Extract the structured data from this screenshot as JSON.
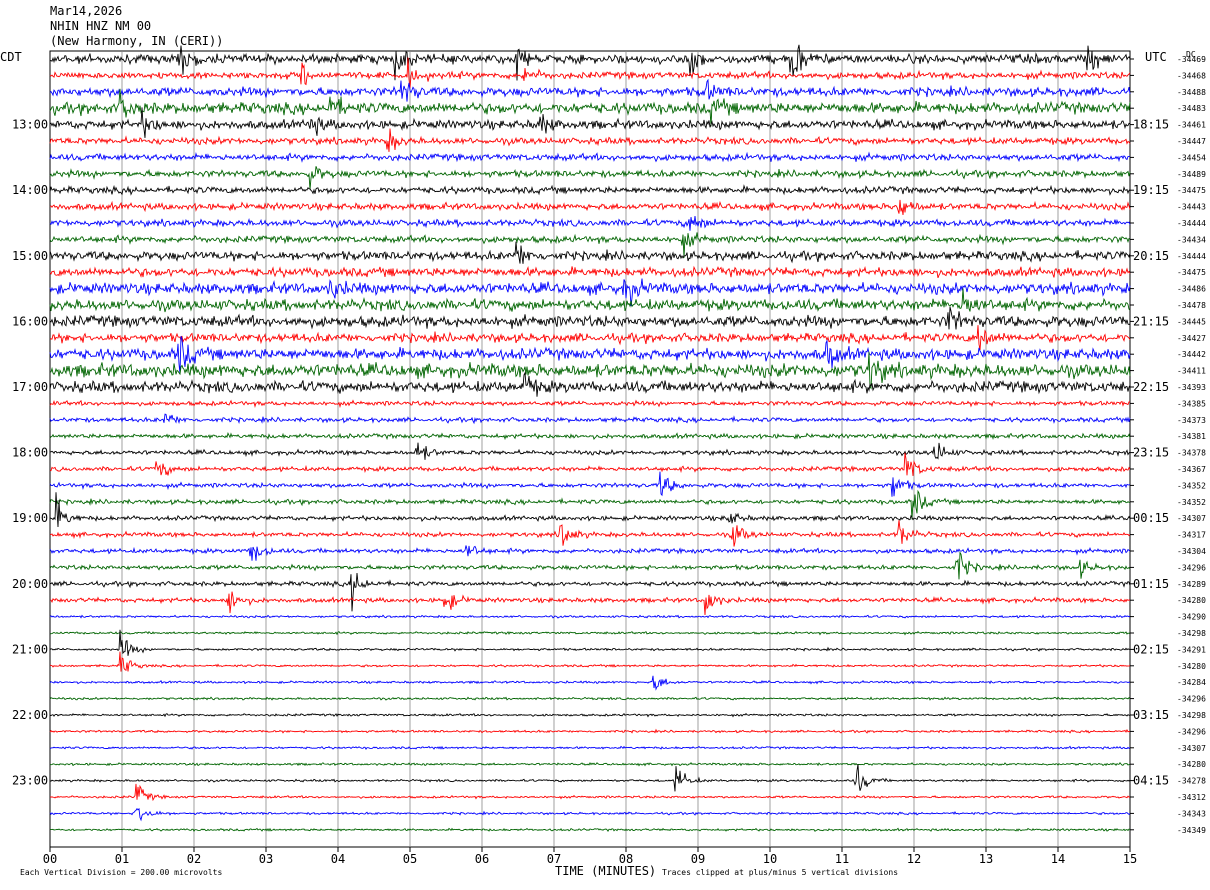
{
  "header": {
    "date": "Mar14,2026",
    "station": "NHIN HNZ NM 00",
    "location": "(New Harmony, IN (CERI))"
  },
  "left_tz": "CDT",
  "right_tz": "UTC",
  "dc_label": "DC",
  "footer": {
    "scale_note": "Each Vertical Division =  200.00 microvolts",
    "xlabel": "TIME (MINUTES)",
    "clip_note": "Traces clipped at plus/minus 5 vertical divisions"
  },
  "colors": [
    "#000000",
    "#ff0000",
    "#0000ff",
    "#006400"
  ],
  "chart_data": {
    "type": "line",
    "xlabel": "TIME (MINUTES)",
    "xlim": [
      0,
      15
    ],
    "x_ticks": [
      "00",
      "01",
      "02",
      "03",
      "04",
      "05",
      "06",
      "07",
      "08",
      "09",
      "10",
      "11",
      "12",
      "13",
      "14",
      "15"
    ],
    "left_hour_labels": [
      "13:00",
      "14:00",
      "15:00",
      "16:00",
      "17:00",
      "18:00",
      "19:00",
      "20:00",
      "21:00",
      "22:00",
      "23:00"
    ],
    "right_hour_labels": [
      "18:15",
      "19:15",
      "20:15",
      "21:15",
      "22:15",
      "23:15",
      "00:15",
      "01:15",
      "02:15",
      "03:15",
      "04:15"
    ],
    "dc_offsets": [
      "-34469",
      "-34468",
      "-34488",
      "-34483",
      "-34461",
      "-34447",
      "-34454",
      "-34489",
      "-34475",
      "-34443",
      "-34444",
      "-34434",
      "-34444",
      "-34475",
      "-34486",
      "-34478",
      "-34445",
      "-34427",
      "-34442",
      "-34411",
      "-34393",
      "-34385",
      "-34373",
      "-34381",
      "-34378",
      "-34367",
      "-34352",
      "-34352",
      "-34307",
      "-34317",
      "-34304",
      "-34296",
      "-34289",
      "-34280",
      "-34290",
      "-34298",
      "-34291",
      "-34280",
      "-34284",
      "-34296",
      "-34298",
      "-34296",
      "-34307",
      "-34280",
      "-34278",
      "-34312",
      "-34343",
      "-34349"
    ],
    "trace_noise_levels": [
      4,
      3,
      4,
      5,
      4,
      3,
      3,
      3,
      3,
      3,
      3,
      3,
      4,
      4,
      5,
      5,
      5,
      4,
      5,
      6,
      5,
      2,
      2,
      2,
      2,
      2,
      2,
      2,
      2,
      2,
      2,
      2,
      2,
      2,
      1,
      1,
      1,
      1,
      1,
      1,
      1,
      1,
      1,
      1,
      1,
      1,
      1,
      1
    ],
    "events": [
      {
        "trace": 0,
        "minute": 1.8,
        "amp": 18
      },
      {
        "trace": 0,
        "minute": 4.8,
        "amp": 16
      },
      {
        "trace": 0,
        "minute": 6.5,
        "amp": 14
      },
      {
        "trace": 0,
        "minute": 8.9,
        "amp": 14
      },
      {
        "trace": 0,
        "minute": 10.3,
        "amp": 26
      },
      {
        "trace": 0,
        "minute": 14.4,
        "amp": 16
      },
      {
        "trace": 1,
        "minute": 3.5,
        "amp": 12
      },
      {
        "trace": 1,
        "minute": 5.0,
        "amp": 10
      },
      {
        "trace": 1,
        "minute": 6.6,
        "amp": 10
      },
      {
        "trace": 2,
        "minute": 4.9,
        "amp": 14
      },
      {
        "trace": 2,
        "minute": 9.1,
        "amp": 10
      },
      {
        "trace": 3,
        "minute": 1.0,
        "amp": 12
      },
      {
        "trace": 3,
        "minute": 3.9,
        "amp": 12
      },
      {
        "trace": 3,
        "minute": 9.2,
        "amp": 10
      },
      {
        "trace": 4,
        "minute": 1.3,
        "amp": 10
      },
      {
        "trace": 4,
        "minute": 3.6,
        "amp": 12
      },
      {
        "trace": 4,
        "minute": 6.8,
        "amp": 10
      },
      {
        "trace": 5,
        "minute": 4.7,
        "amp": 10
      },
      {
        "trace": 7,
        "minute": 3.6,
        "amp": 12
      },
      {
        "trace": 9,
        "minute": 11.8,
        "amp": 12
      },
      {
        "trace": 10,
        "minute": 8.9,
        "amp": 12
      },
      {
        "trace": 11,
        "minute": 8.8,
        "amp": 10
      },
      {
        "trace": 12,
        "minute": 6.5,
        "amp": 12
      },
      {
        "trace": 14,
        "minute": 8.0,
        "amp": 16
      },
      {
        "trace": 14,
        "minute": 3.9,
        "amp": 10
      },
      {
        "trace": 15,
        "minute": 12.7,
        "amp": 16
      },
      {
        "trace": 16,
        "minute": 12.5,
        "amp": 12
      },
      {
        "trace": 17,
        "minute": 12.9,
        "amp": 16
      },
      {
        "trace": 18,
        "minute": 1.8,
        "amp": 18
      },
      {
        "trace": 18,
        "minute": 10.8,
        "amp": 14
      },
      {
        "trace": 19,
        "minute": 11.4,
        "amp": 16
      },
      {
        "trace": 20,
        "minute": 6.6,
        "amp": 12
      },
      {
        "trace": 22,
        "minute": 1.6,
        "amp": 8
      },
      {
        "trace": 24,
        "minute": 5.1,
        "amp": 12
      },
      {
        "trace": 24,
        "minute": 12.3,
        "amp": 12
      },
      {
        "trace": 25,
        "minute": 1.5,
        "amp": 10
      },
      {
        "trace": 25,
        "minute": 11.9,
        "amp": 16
      },
      {
        "trace": 26,
        "minute": 8.5,
        "amp": 12
      },
      {
        "trace": 26,
        "minute": 11.7,
        "amp": 16
      },
      {
        "trace": 27,
        "minute": 12.0,
        "amp": 16
      },
      {
        "trace": 28,
        "minute": 0.1,
        "amp": 16
      },
      {
        "trace": 28,
        "minute": 9.4,
        "amp": 10
      },
      {
        "trace": 29,
        "minute": 7.1,
        "amp": 16
      },
      {
        "trace": 29,
        "minute": 9.5,
        "amp": 12
      },
      {
        "trace": 29,
        "minute": 11.8,
        "amp": 14
      },
      {
        "trace": 30,
        "minute": 2.8,
        "amp": 14
      },
      {
        "trace": 30,
        "minute": 5.8,
        "amp": 8
      },
      {
        "trace": 31,
        "minute": 12.6,
        "amp": 18
      },
      {
        "trace": 31,
        "minute": 14.3,
        "amp": 8
      },
      {
        "trace": 32,
        "minute": 4.2,
        "amp": 18
      },
      {
        "trace": 33,
        "minute": 2.5,
        "amp": 14
      },
      {
        "trace": 33,
        "minute": 5.5,
        "amp": 12
      },
      {
        "trace": 33,
        "minute": 9.1,
        "amp": 16
      },
      {
        "trace": 36,
        "minute": 1.0,
        "amp": 14
      },
      {
        "trace": 37,
        "minute": 1.0,
        "amp": 12
      },
      {
        "trace": 38,
        "minute": 8.4,
        "amp": 10
      },
      {
        "trace": 44,
        "minute": 8.7,
        "amp": 16
      },
      {
        "trace": 44,
        "minute": 11.2,
        "amp": 18
      },
      {
        "trace": 45,
        "minute": 1.2,
        "amp": 14
      },
      {
        "trace": 46,
        "minute": 1.2,
        "amp": 18
      }
    ]
  }
}
